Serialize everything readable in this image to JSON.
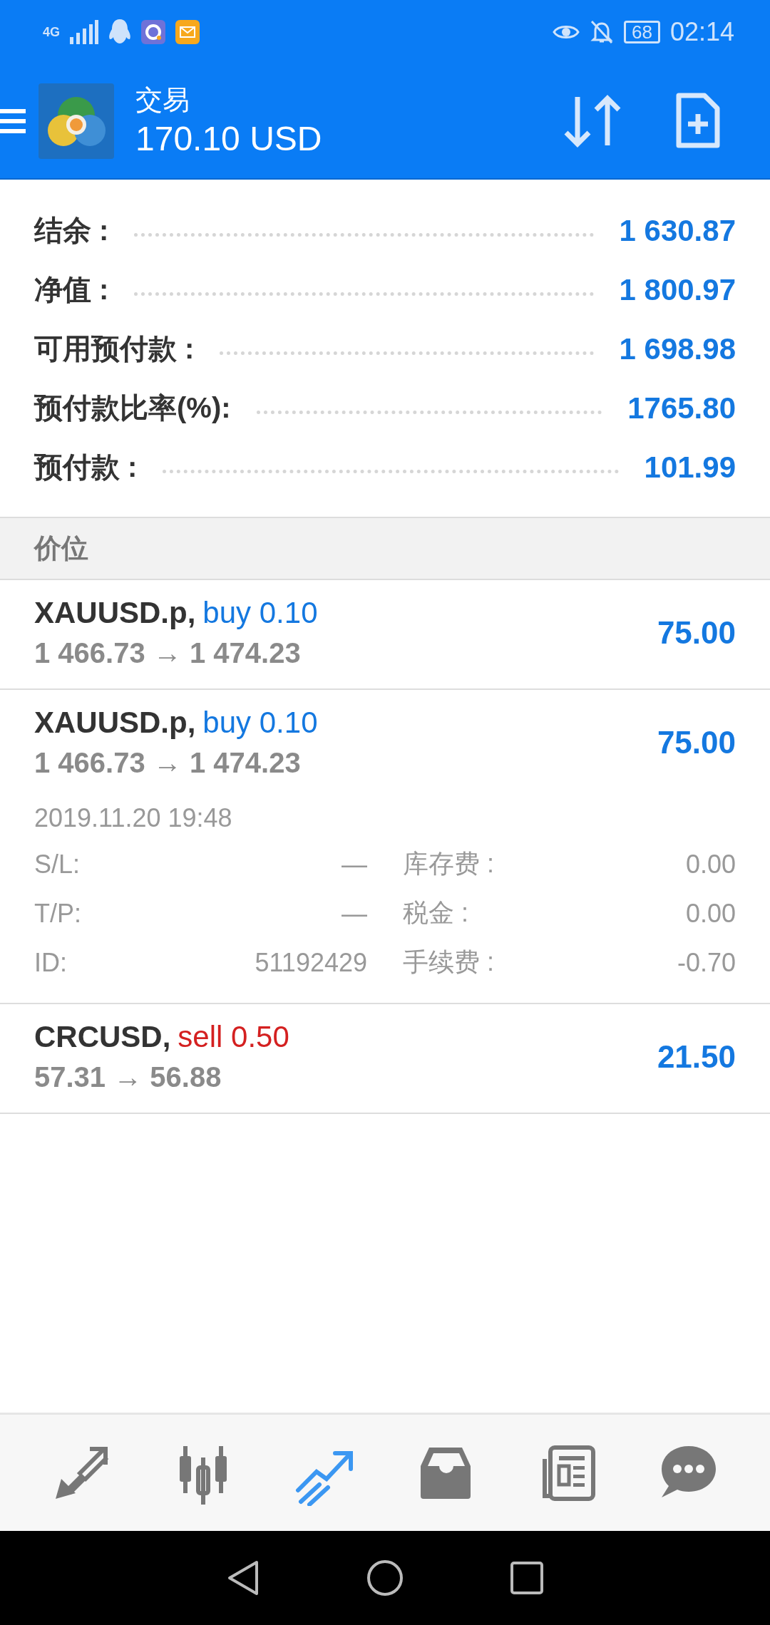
{
  "status_bar": {
    "network": "4G",
    "battery": "68",
    "time": "02:14"
  },
  "header": {
    "title": "交易",
    "balance": "170.10 USD"
  },
  "summary": [
    {
      "label": "结余 :",
      "value": "1 630.87"
    },
    {
      "label": "净值 :",
      "value": "1 800.97"
    },
    {
      "label": "可用预付款 :",
      "value": "1 698.98"
    },
    {
      "label": "预付款比率(%):",
      "value": "1765.80"
    },
    {
      "label": "预付款 :",
      "value": "101.99"
    }
  ],
  "section": {
    "title": "价位"
  },
  "positions": [
    {
      "symbol": "XAUUSD.p,",
      "kind": "buy",
      "order": "buy 0.10",
      "prices": "1 466.73 → 1 474.23",
      "profit": "75.00"
    },
    {
      "symbol": "XAUUSD.p,",
      "kind": "buy",
      "order": "buy 0.10",
      "prices": "1 466.73 → 1 474.23",
      "profit": "75.00",
      "time": "2019.11.20 19:48",
      "details": [
        {
          "label": "S/L:",
          "value": "—"
        },
        {
          "label": "库存费 :",
          "value": "0.00"
        },
        {
          "label": "T/P:",
          "value": "—"
        },
        {
          "label": "税金 :",
          "value": "0.00"
        },
        {
          "label": "ID:",
          "value": "51192429"
        },
        {
          "label": "手续费 :",
          "value": "-0.70"
        }
      ]
    },
    {
      "symbol": "CRCUSD,",
      "kind": "sell",
      "order": "sell 0.50",
      "prices": "57.31 → 56.88",
      "profit": "21.50"
    }
  ],
  "bottom_nav": [
    {
      "selected": false
    },
    {
      "selected": false
    },
    {
      "selected": true
    },
    {
      "selected": false
    },
    {
      "selected": false
    },
    {
      "selected": false
    }
  ]
}
